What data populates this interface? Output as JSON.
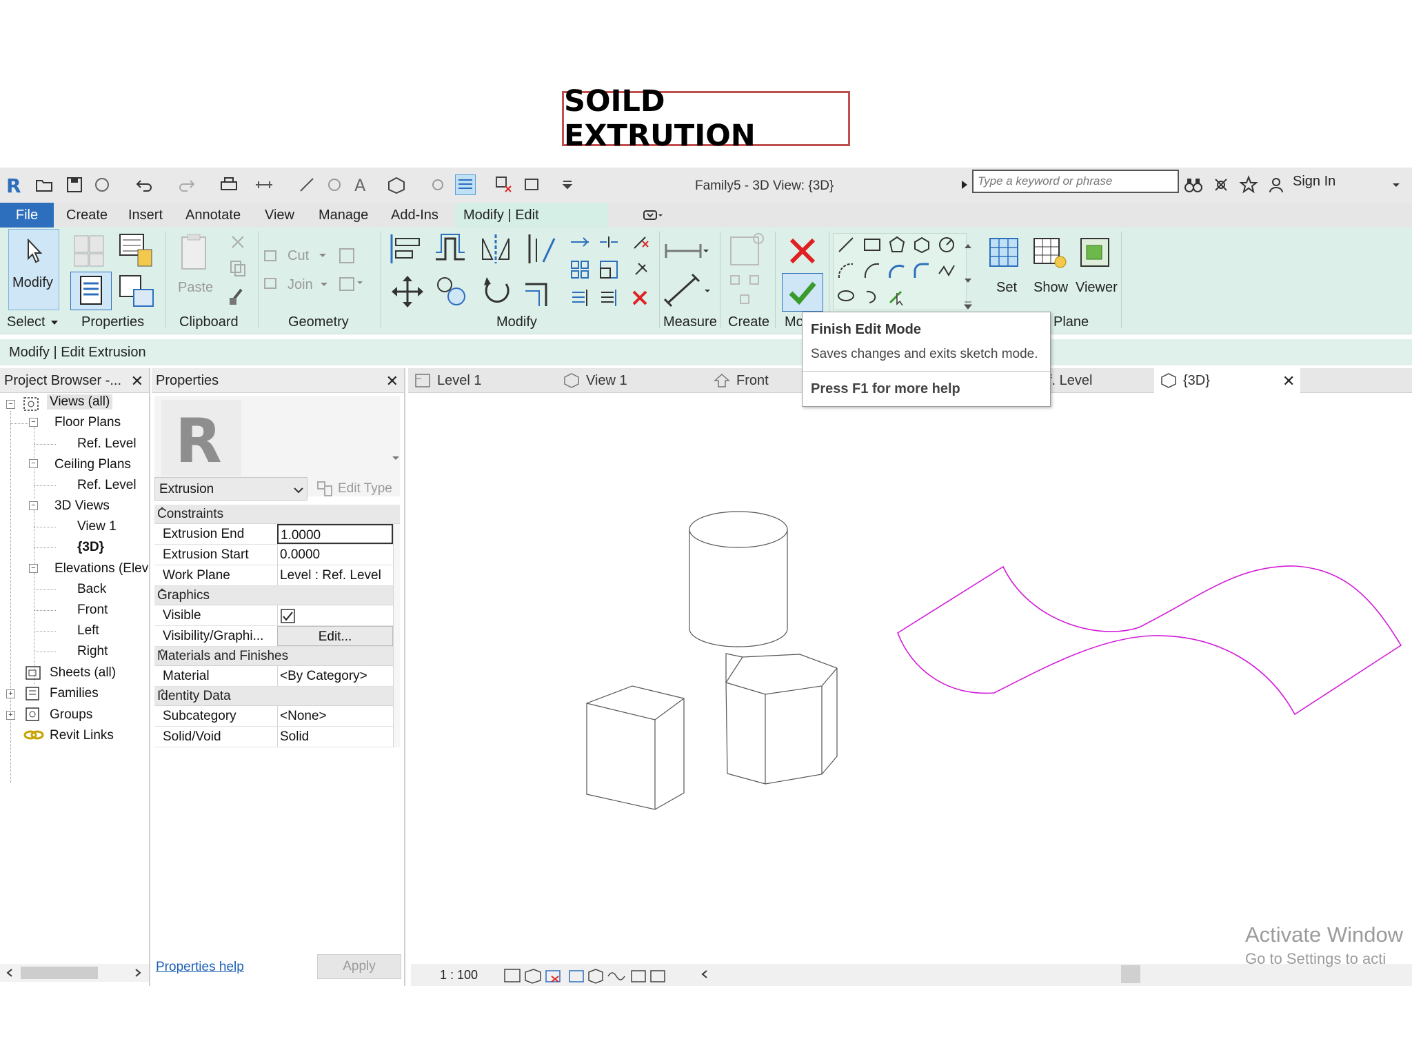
{
  "slide": {
    "title": "SOILD EXTRUTION"
  },
  "window": {
    "title": "Family5 - 3D View: {3D}"
  },
  "search": {
    "placeholder": "Type a keyword or phrase"
  },
  "account": {
    "sign_in": "Sign In"
  },
  "menu": {
    "file": "File",
    "tabs": [
      "Create",
      "Insert",
      "Annotate",
      "View",
      "Manage",
      "Add-Ins",
      "Modify | Edit Extrusion"
    ]
  },
  "ribbon": {
    "modify_label": "Modify",
    "select_label": "Select",
    "properties_label": "Properties",
    "paste_label": "Paste",
    "clipboard_label": "Clipboard",
    "cut_label": "Cut",
    "join_label": "Join",
    "geometry_label": "Geometry",
    "modify_panel_label": "Modify",
    "measure_label": "Measure",
    "create_label": "Create",
    "mode_label": "Mo",
    "set_label": "Set",
    "show_label": "Show",
    "viewer_label": "Viewer",
    "plane_label": "Plane"
  },
  "tooltip": {
    "title": "Finish Edit Mode",
    "description": "Saves changes and exits sketch mode.",
    "help": "Press F1 for more help"
  },
  "options_bar": {
    "label": "Modify | Edit Extrusion"
  },
  "project_browser": {
    "title": "Project Browser -...",
    "items": {
      "views_all": "Views (all)",
      "floor_plans": "Floor Plans",
      "floor_ref_level": "Ref. Level",
      "ceiling_plans": "Ceiling Plans",
      "ceiling_ref_level": "Ref. Level",
      "views_3d": "3D Views",
      "view1": "View 1",
      "view_3d": "{3D}",
      "elevations": "Elevations (Elev",
      "back": "Back",
      "front": "Front",
      "left": "Left",
      "right": "Right",
      "sheets": "Sheets (all)",
      "families": "Families",
      "groups": "Groups",
      "revit_links": "Revit Links"
    }
  },
  "properties": {
    "title": "Properties",
    "type_selector": "Extrusion",
    "edit_type": "Edit Type",
    "groups": {
      "constraints": "Constraints",
      "graphics": "Graphics",
      "materials": "Materials and Finishes",
      "identity": "Identity Data"
    },
    "rows": {
      "extrusion_end": {
        "label": "Extrusion End",
        "value": "1.0000"
      },
      "extrusion_start": {
        "label": "Extrusion Start",
        "value": "0.0000"
      },
      "work_plane": {
        "label": "Work Plane",
        "value": "Level : Ref. Level"
      },
      "visible": {
        "label": "Visible",
        "checked": true
      },
      "visibility_graphics": {
        "label": "Visibility/Graphi...",
        "value": "Edit..."
      },
      "material": {
        "label": "Material",
        "value": "<By Category>"
      },
      "subcategory": {
        "label": "Subcategory",
        "value": "<None>"
      },
      "solid_void": {
        "label": "Solid/Void",
        "value": "Solid"
      }
    },
    "help_link": "Properties help",
    "apply": "Apply"
  },
  "view_tabs": [
    "Level 1",
    "View 1",
    "Front",
    "f. Level",
    "{3D}"
  ],
  "view_status": {
    "scale": "1 : 100"
  },
  "watermark": {
    "line1": "Activate Window",
    "line2": "Go to Settings to acti"
  },
  "colors": {
    "file_tab": "#2d6fbd",
    "ribbon_bg": "#dcf0e9",
    "sketch": "#d21bd8",
    "title_border": "#c0504d"
  }
}
